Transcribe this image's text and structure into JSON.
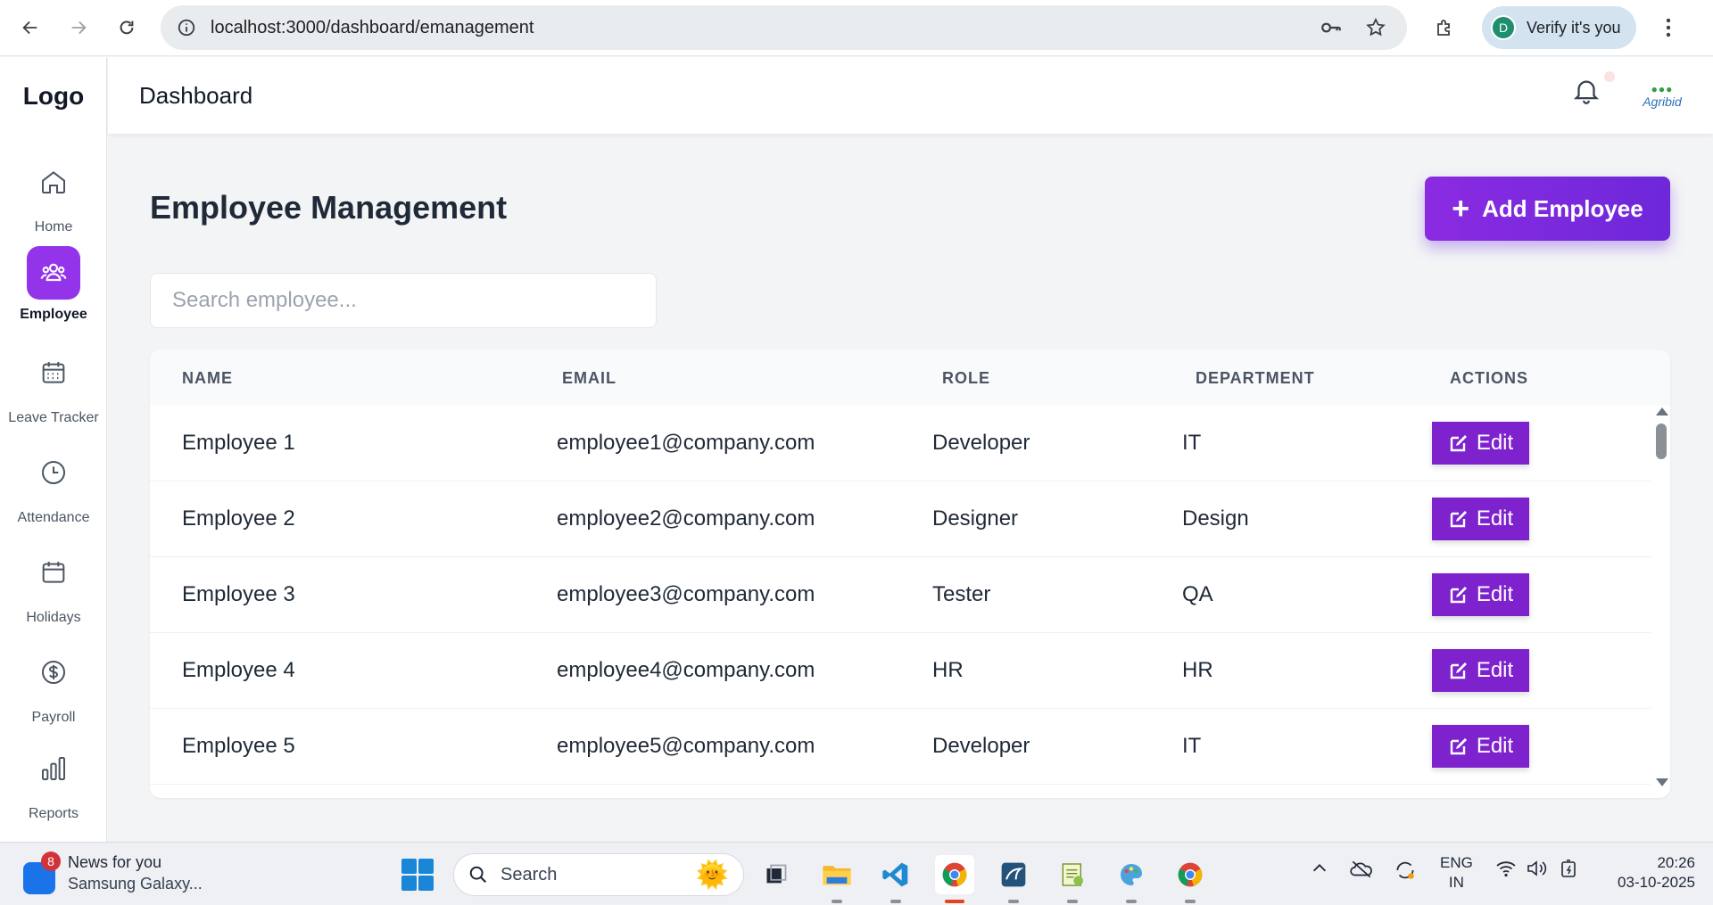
{
  "browser": {
    "url": "localhost:3000/dashboard/emanagement",
    "profile_initial": "D",
    "verify_label": "Verify it's you"
  },
  "sidebar": {
    "logo": "Logo",
    "items": [
      {
        "label": "Home",
        "icon": "home-icon"
      },
      {
        "label": "Employee",
        "icon": "users-icon",
        "active": true
      },
      {
        "label": "Leave Tracker",
        "icon": "calendar-grid-icon"
      },
      {
        "label": "Attendance",
        "icon": "clock-icon"
      },
      {
        "label": "Holidays",
        "icon": "calendar-icon"
      },
      {
        "label": "Payroll",
        "icon": "dollar-icon"
      },
      {
        "label": "Reports",
        "icon": "bar-chart-icon"
      }
    ]
  },
  "header": {
    "title": "Dashboard",
    "brand_avatar_text": "Agribid"
  },
  "main": {
    "title": "Employee Management",
    "add_button": "Add Employee",
    "search_placeholder": "Search employee...",
    "columns": [
      "NAME",
      "EMAIL",
      "ROLE",
      "DEPARTMENT",
      "ACTIONS"
    ],
    "rows": [
      {
        "name": "Employee 1",
        "email": "employee1@company.com",
        "role": "Developer",
        "department": "IT",
        "action": "Edit"
      },
      {
        "name": "Employee 2",
        "email": "employee2@company.com",
        "role": "Designer",
        "department": "Design",
        "action": "Edit"
      },
      {
        "name": "Employee 3",
        "email": "employee3@company.com",
        "role": "Tester",
        "department": "QA",
        "action": "Edit"
      },
      {
        "name": "Employee 4",
        "email": "employee4@company.com",
        "role": "HR",
        "department": "HR",
        "action": "Edit"
      },
      {
        "name": "Employee 5",
        "email": "employee5@company.com",
        "role": "Developer",
        "department": "IT",
        "action": "Edit"
      }
    ]
  },
  "taskbar": {
    "news_badge": "8",
    "news_title": "News for you",
    "news_sub": "Samsung Galaxy...",
    "search_label": "Search",
    "lang_1": "ENG",
    "lang_2": "IN",
    "time": "20:26",
    "date": "03-10-2025"
  },
  "colors": {
    "accent": "#9333ea",
    "edit_button": "#7e22ce"
  }
}
